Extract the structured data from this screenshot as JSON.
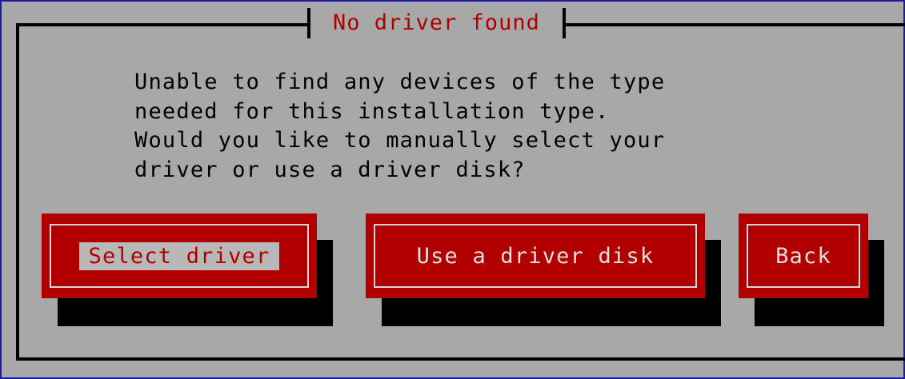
{
  "dialog": {
    "title": "No driver found",
    "message_lines": [
      "Unable to find any devices of the type",
      "needed for this installation type.",
      "Would you like to manually select your",
      "driver or use a driver disk?"
    ]
  },
  "buttons": {
    "select_driver": "Select driver",
    "use_driver_disk": "Use a driver disk",
    "back": "Back"
  },
  "colors": {
    "background": "#a8a8a8",
    "button": "#b20000",
    "title_text": "#b00000",
    "shadow": "#000000"
  }
}
